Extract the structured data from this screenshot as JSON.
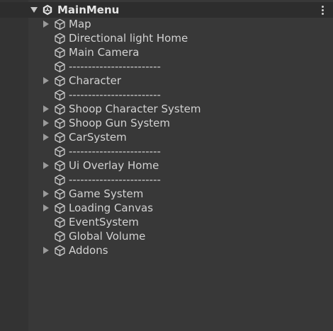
{
  "hierarchy": {
    "scene_name": "MainMenu",
    "scene_icon": "unity-icon",
    "menu_icon": "kebab-menu-icon",
    "items": [
      {
        "label": "Map",
        "has_children": true
      },
      {
        "label": "Directional light Home",
        "has_children": false
      },
      {
        "label": "Main Camera",
        "has_children": false
      },
      {
        "label": "------------------------",
        "has_children": false
      },
      {
        "label": "Character",
        "has_children": true
      },
      {
        "label": "------------------------",
        "has_children": false
      },
      {
        "label": "Shoop Character System",
        "has_children": true
      },
      {
        "label": "Shoop Gun System",
        "has_children": true
      },
      {
        "label": "CarSystem",
        "has_children": true
      },
      {
        "label": "------------------------",
        "has_children": false
      },
      {
        "label": "Ui Overlay Home",
        "has_children": true
      },
      {
        "label": "------------------------",
        "has_children": false
      },
      {
        "label": "Game System",
        "has_children": true
      },
      {
        "label": "Loading Canvas",
        "has_children": true
      },
      {
        "label": "EventSystem",
        "has_children": false
      },
      {
        "label": "Global Volume",
        "has_children": false
      },
      {
        "label": "Addons",
        "has_children": true
      }
    ]
  },
  "colors": {
    "background": "#383838",
    "gutter": "#333333",
    "header": "#2d2d2d",
    "text": "#d2d2d2"
  }
}
